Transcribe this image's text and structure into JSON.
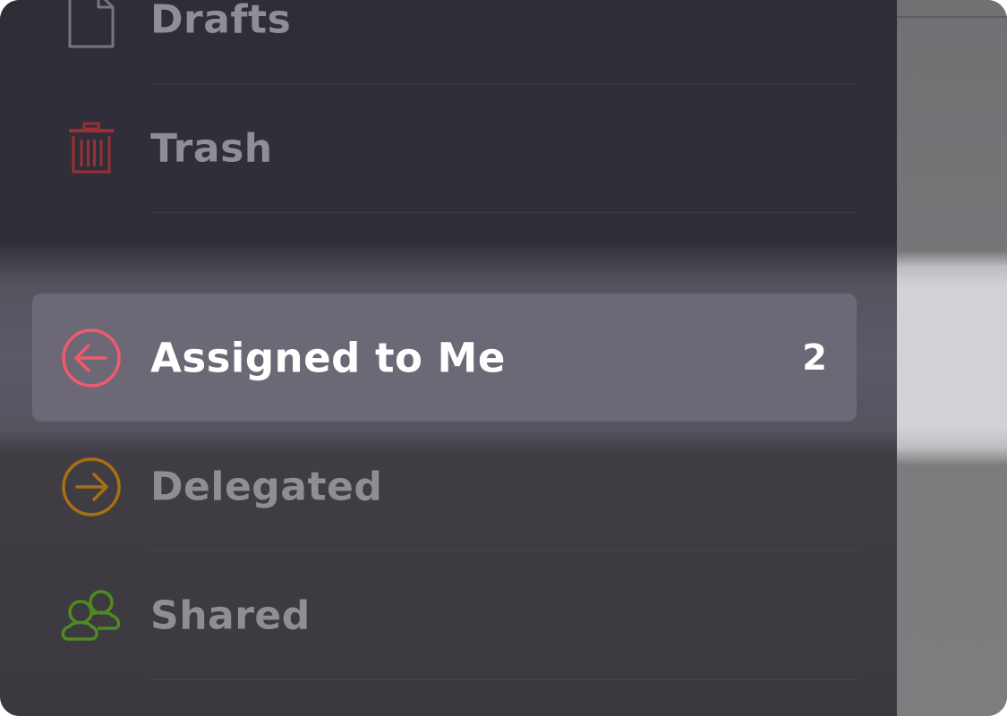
{
  "sidebar": {
    "items": [
      {
        "label": "Drafts",
        "icon": "document-icon",
        "color": "#7a7980"
      },
      {
        "label": "Trash",
        "icon": "trash-icon",
        "color": "#9b2f34"
      },
      {
        "label": "Assigned to Me",
        "icon": "arrow-left-circle-icon",
        "color": "#f05a6e",
        "count": "2",
        "selected": true
      },
      {
        "label": "Delegated",
        "icon": "arrow-right-circle-icon",
        "color": "#a86f14"
      },
      {
        "label": "Shared",
        "icon": "people-icon",
        "color": "#4f8a1f"
      }
    ]
  },
  "colors": {
    "sidebar_background": "#2f2e38",
    "selected_background": "#6c6875",
    "inactive_text": "#8f8e95",
    "active_text": "#ffffff"
  }
}
